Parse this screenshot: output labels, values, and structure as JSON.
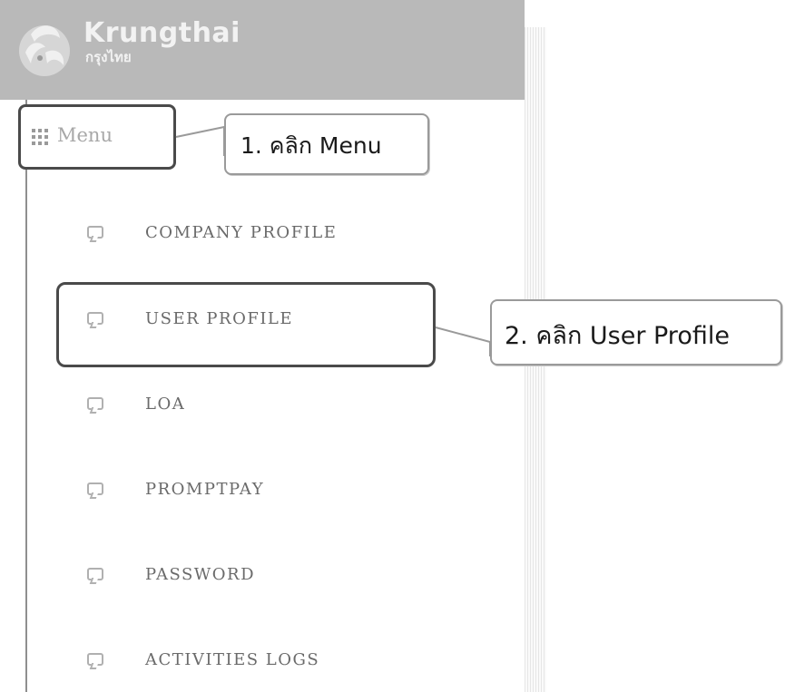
{
  "header": {
    "brand_name": "Krungthai",
    "brand_sub": "กรุงไทย"
  },
  "menu": {
    "label": "Menu"
  },
  "items": [
    {
      "label": "COMPANY PROFILE"
    },
    {
      "label": "USER PROFILE"
    },
    {
      "label": "LOA"
    },
    {
      "label": "PROMPTPAY"
    },
    {
      "label": "PASSWORD"
    },
    {
      "label": "ACTIVITIES LOGS"
    }
  ],
  "callouts": {
    "step1": "1. คลิก Menu",
    "step2": "2. คลิก User Profile"
  },
  "colors": {
    "header_bg": "#b9b9b9",
    "highlight_border": "#4a4a4a"
  },
  "icons": {
    "logo": "krungthai-bird-logo",
    "menu": "grid-icon",
    "item": "chat-bubble-icon"
  }
}
